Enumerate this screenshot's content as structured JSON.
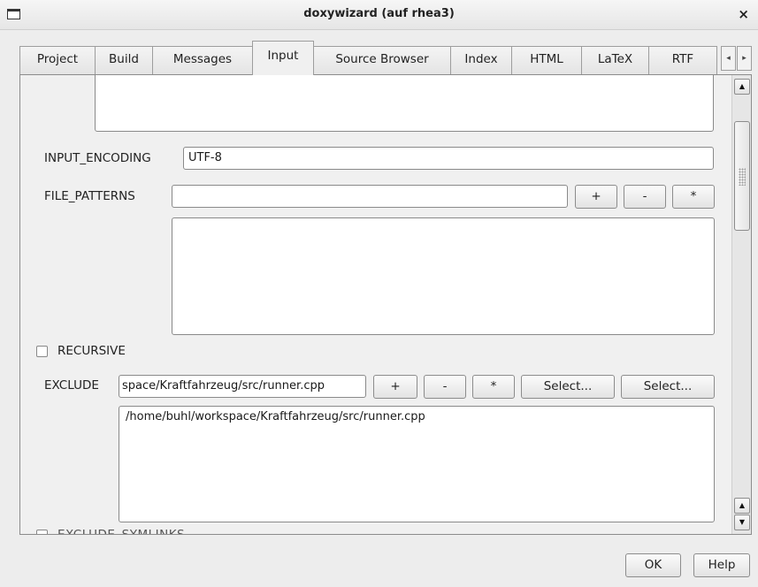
{
  "window": {
    "title": "doxywizard (auf rhea3)",
    "close_glyph": "×"
  },
  "tabs": [
    {
      "label": "Project"
    },
    {
      "label": "Build"
    },
    {
      "label": "Messages"
    },
    {
      "label": "Input",
      "active": true
    },
    {
      "label": "Source Browser"
    },
    {
      "label": "Index"
    },
    {
      "label": "HTML"
    },
    {
      "label": "LaTeX"
    },
    {
      "label": "RTF"
    }
  ],
  "tab_scroll": {
    "left_glyph": "◂",
    "right_glyph": "▸"
  },
  "input_encoding": {
    "label": "INPUT_ENCODING",
    "value": "UTF-8"
  },
  "file_patterns": {
    "label": "FILE_PATTERNS",
    "value": "",
    "add_label": "+",
    "remove_label": "-",
    "edit_label": "*"
  },
  "recursive": {
    "label": "RECURSIVE",
    "checked": false
  },
  "exclude": {
    "label": "EXCLUDE",
    "value": "space/Kraftfahrzeug/src/runner.cpp",
    "add_label": "+",
    "remove_label": "-",
    "edit_label": "*",
    "select_file_label": "Select...",
    "select_dir_label": "Select...",
    "items": [
      "/home/buhl/workspace/Kraftfahrzeug/src/runner.cpp"
    ]
  },
  "cut_off_label": "EXCLUDE_SYMLINKS",
  "scrollbar": {
    "up_glyph": "▲",
    "down_glyph": "▼"
  },
  "footer": {
    "ok_label": "OK",
    "help_label": "Help"
  }
}
